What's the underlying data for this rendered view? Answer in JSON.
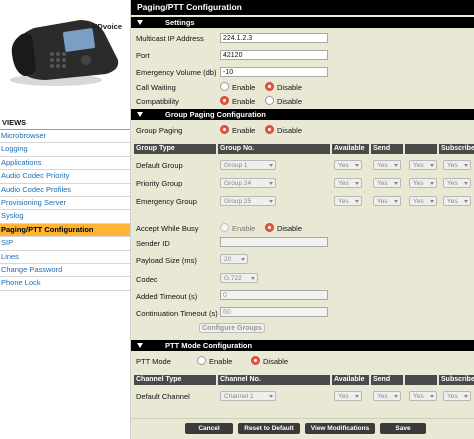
{
  "brand": {
    "badge": "HDvoice"
  },
  "views": {
    "header": "VIEWS",
    "items": [
      {
        "label": "Microbrowser",
        "active": false
      },
      {
        "label": "Logging",
        "active": false
      },
      {
        "label": "Applications",
        "active": false
      },
      {
        "label": "Audio Codec Priority",
        "active": false
      },
      {
        "label": "Audio Codec Profiles",
        "active": false
      },
      {
        "label": "Provisioning Server",
        "active": false
      },
      {
        "label": "Syslog",
        "active": false
      },
      {
        "label": "Paging/PTT Configuration",
        "active": true
      },
      {
        "label": "SIP",
        "active": false
      },
      {
        "label": "Lines",
        "active": false
      },
      {
        "label": "Change Password",
        "active": false
      },
      {
        "label": "Phone Lock",
        "active": false
      }
    ]
  },
  "page": {
    "title": "Paging/PTT Configuration"
  },
  "settings": {
    "header": "Settings",
    "multicast_label": "Multicast IP Address",
    "multicast_value": "224.1.2.3",
    "port_label": "Port",
    "port_value": "42120",
    "volume_label": "Emergency Volume (db)",
    "volume_value": "-10",
    "call_waiting_label": "Call Waiting",
    "compat_label": "Compatibility",
    "enable": "Enable",
    "disable": "Disable"
  },
  "group_paging": {
    "header": "Group Paging Configuration",
    "label": "Group Paging",
    "enable": "Enable",
    "disable": "Disable",
    "columns": [
      "Group Type",
      "Group No.",
      "Available",
      "Send",
      "",
      "Subscribe"
    ],
    "rows": [
      {
        "type": "Default Group",
        "group": "Group 1",
        "available": "Yes",
        "send": "Yes",
        "extra": "Yes",
        "subscribe": "Yes"
      },
      {
        "type": "Priority Group",
        "group": "Group 24",
        "available": "Yes",
        "send": "Yes",
        "extra": "Yes",
        "subscribe": "Yes"
      },
      {
        "type": "Emergency Group",
        "group": "Group 25",
        "available": "Yes",
        "send": "Yes",
        "extra": "Yes",
        "subscribe": "Yes"
      }
    ],
    "accept_busy_label": "Accept While Busy",
    "sender_id_label": "Sender ID",
    "sender_id_value": "",
    "payload_label": "Payload Size (ms)",
    "payload_value": "20",
    "codec_label": "Codec",
    "codec_value": "G.722",
    "added_timeout_label": "Added Timeout (s)",
    "added_timeout_value": "0",
    "continuation_label": "Continuation Timeout (s)",
    "continuation_value": "60",
    "configure_button": "Configure Groups"
  },
  "ptt": {
    "header": "PTT Mode Configuration",
    "label": "PTT Mode",
    "enable": "Enable",
    "disable": "Disable",
    "columns": [
      "Channel Type",
      "Channel No.",
      "Available",
      "Send",
      "",
      "Subscribe"
    ],
    "rows": [
      {
        "type": "Default Channel",
        "channel": "Channel 1",
        "available": "Yes",
        "send": "Yes",
        "extra": "Yes",
        "subscribe": "Yes"
      }
    ]
  },
  "actions": {
    "cancel": "Cancel",
    "reset": "Reset to Default",
    "view_mods": "View Modifications",
    "save": "Save"
  },
  "colors": {
    "accent": "#ffb433",
    "link": "#1c6cb0",
    "panel": "#e8e8d4",
    "radio_on": "#e8573a"
  }
}
